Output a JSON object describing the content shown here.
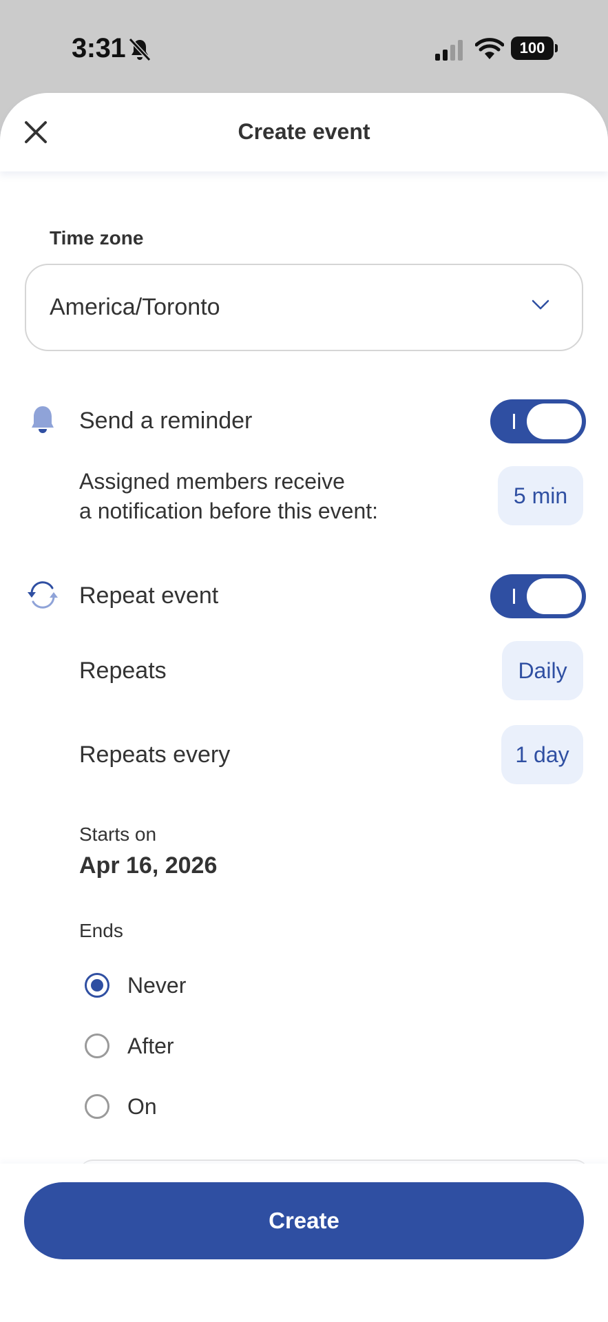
{
  "status_bar": {
    "time": "3:31",
    "battery": "100"
  },
  "header": {
    "title": "Create event"
  },
  "time_zone": {
    "label": "Time zone",
    "value": "America/Toronto"
  },
  "reminder": {
    "title": "Send a reminder",
    "enabled": true,
    "description_line1": "Assigned members receive",
    "description_line2": "a notification before this event:",
    "lead_time": "5 min"
  },
  "repeat": {
    "title": "Repeat event",
    "enabled": true,
    "repeats_label": "Repeats",
    "repeats_value": "Daily",
    "every_label": "Repeats every",
    "every_value": "1 day",
    "starts_label": "Starts on",
    "starts_value": "Apr 16, 2026",
    "ends_label": "Ends",
    "ends_options": [
      "Never",
      "After",
      "On"
    ],
    "ends_selected": "Never"
  },
  "footer": {
    "create_label": "Create"
  },
  "colors": {
    "accent": "#2f4fa2",
    "pill_bg": "#eaf0fb",
    "icon_light": "#8fa3d8"
  }
}
